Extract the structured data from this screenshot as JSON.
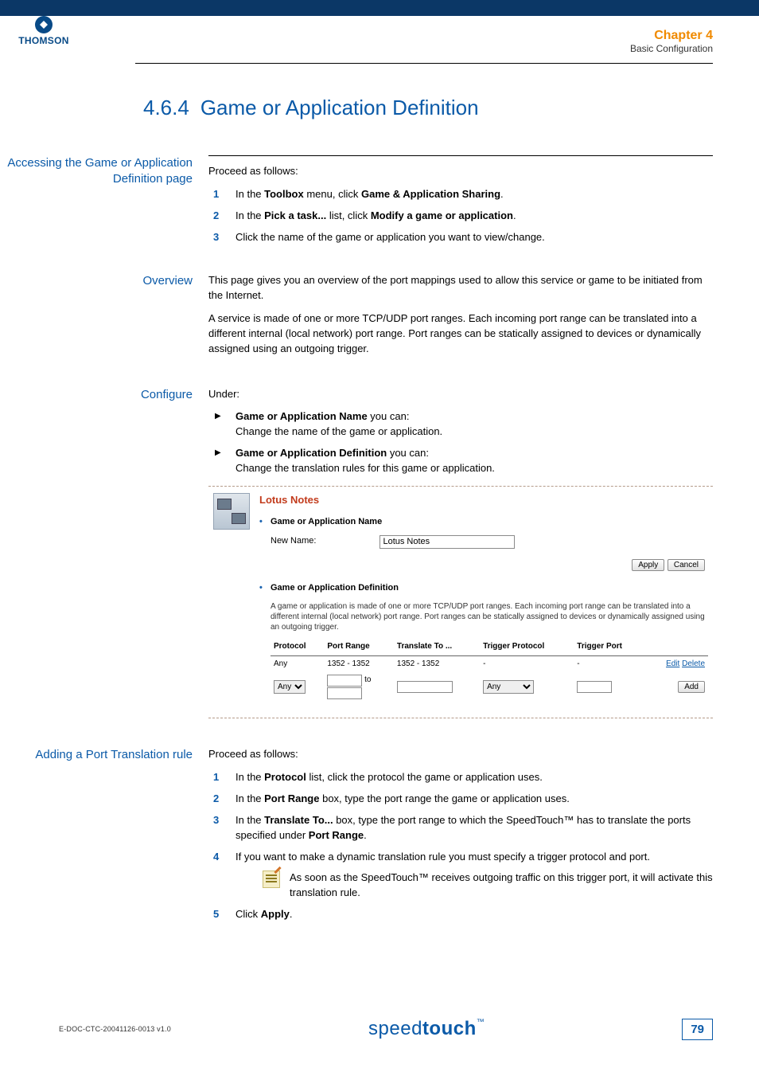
{
  "header": {
    "chapter": "Chapter 4",
    "subtitle": "Basic Configuration"
  },
  "logo": {
    "text": "THOMSON"
  },
  "section": {
    "num": "4.6.4",
    "title": "Game or Application Definition"
  },
  "s1": {
    "heading": "Accessing the Game or Application Definition page",
    "intro": "Proceed as follows:",
    "steps": [
      {
        "pre": "In the ",
        "b1": "Toolbox",
        "mid": " menu, click ",
        "b2": "Game & Application Sharing",
        "post": "."
      },
      {
        "pre": "In the ",
        "b1": "Pick a task...",
        "mid": " list, click ",
        "b2": "Modify a game or application",
        "post": "."
      },
      {
        "pre": "Click the name of the game or application you want to view/change."
      }
    ]
  },
  "s2": {
    "heading": "Overview",
    "p1": "This page gives you an overview of the port mappings used to allow this service or game to be initiated from the Internet.",
    "p2": "A service is made of one or more TCP/UDP port ranges. Each incoming port range can be translated into a different internal (local network) port range. Port ranges can be statically assigned to devices or dynamically assigned using an outgoing trigger."
  },
  "s3": {
    "heading": "Configure",
    "intro": "Under:",
    "bullet1": {
      "b": "Game or Application Name",
      "rest": " you can:",
      "sub": "Change the name of the game or application."
    },
    "bullet2": {
      "b": "Game or Application Definition",
      "rest": " you can:",
      "sub": "Change the translation rules for this game or application."
    },
    "pane": {
      "title": "Lotus Notes",
      "dot1": "Game or Application Name",
      "newname_label": "New Name:",
      "newname_value": "Lotus Notes",
      "apply": "Apply",
      "cancel": "Cancel",
      "dot2": "Game or Application Definition",
      "desc": "A game or application is made of one or more TCP/UDP port ranges. Each incoming port range can be translated into a different internal (local network) port range. Port ranges can be statically assigned to devices or dynamically assigned using an outgoing trigger.",
      "th": {
        "protocol": "Protocol",
        "portrange": "Port Range",
        "translate": "Translate To ...",
        "tprotocol": "Trigger Protocol",
        "tport": "Trigger Port",
        "actions": ""
      },
      "row": {
        "protocol": "Any",
        "portrange": "1352 - 1352",
        "translate": "1352 - 1352",
        "tprotocol": "-",
        "tport": "-",
        "edit": "Edit",
        "del": "Delete"
      },
      "inputrow": {
        "sel1": "Any",
        "to": "to",
        "sel2": "Any",
        "add": "Add"
      }
    }
  },
  "s4": {
    "heading": "Adding a Port Translation rule",
    "intro": "Proceed as follows:",
    "step1": {
      "pre": "In the ",
      "b": "Protocol",
      "post": " list, click the protocol the game or application uses."
    },
    "step2": {
      "pre": "In the ",
      "b": "Port Range",
      "post": " box, type the port range the game or application uses."
    },
    "step3": {
      "pre": "In the ",
      "b": "Translate To...",
      "post1": " box, type the port range to which the SpeedTouch™ has to translate the ports specified under ",
      "b2": "Port Range",
      "post2": "."
    },
    "step4": {
      "text": "If you want to make a dynamic translation rule you must specify a trigger protocol and port."
    },
    "note": "As soon as the SpeedTouch™ receives outgoing traffic on this trigger port, it will activate this translation rule.",
    "step5": {
      "pre": "Click ",
      "b": "Apply",
      "post": "."
    }
  },
  "footer": {
    "doc": "E-DOC-CTC-20041126-0013 v1.0",
    "brand_a": "speed",
    "brand_b": "touch",
    "tm": "™",
    "page": "79"
  },
  "chart_data": {
    "type": "table",
    "title": "Port translation rules — Lotus Notes",
    "columns": [
      "Protocol",
      "Port Range",
      "Translate To ...",
      "Trigger Protocol",
      "Trigger Port"
    ],
    "rows": [
      [
        "Any",
        "1352 - 1352",
        "1352 - 1352",
        "-",
        "-"
      ]
    ]
  }
}
